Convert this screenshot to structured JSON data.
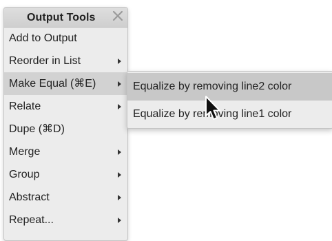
{
  "menu": {
    "title": "Output Tools",
    "items": [
      {
        "label": "Add to Output",
        "has_submenu": false
      },
      {
        "label": "Reorder in List",
        "has_submenu": true
      },
      {
        "label": "Make Equal (⌘E)",
        "has_submenu": true,
        "active": true
      },
      {
        "label": "Relate",
        "has_submenu": true
      },
      {
        "label": "Dupe (⌘D)",
        "has_submenu": false
      },
      {
        "label": "Merge",
        "has_submenu": true
      },
      {
        "label": "Group",
        "has_submenu": true
      },
      {
        "label": "Abstract",
        "has_submenu": true
      },
      {
        "label": "Repeat...",
        "has_submenu": true
      }
    ]
  },
  "submenu": {
    "items": [
      {
        "label": "Equalize by removing line2 color",
        "highlighted": true
      },
      {
        "label": "Equalize by removing line1 color",
        "highlighted": false
      }
    ]
  },
  "colors": {
    "menu_bg": "#ececec",
    "active_bg": "#d2d2d2",
    "highlight_bg": "#c8c8c8"
  },
  "icons": {
    "close": "close-icon",
    "submenu_arrow": "chevron-right-icon",
    "cursor": "mouse-pointer-icon"
  }
}
